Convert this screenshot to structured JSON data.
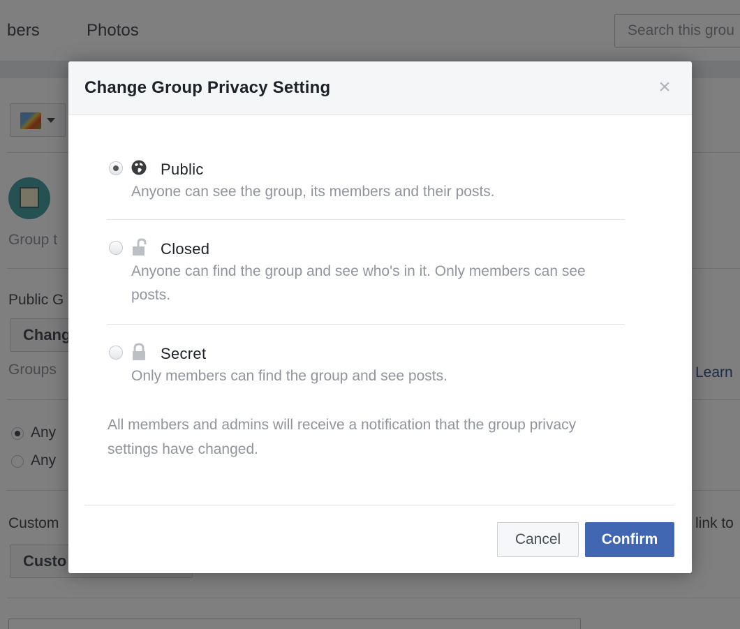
{
  "background": {
    "tabs": [
      "bers",
      "Photos"
    ],
    "search_placeholder": "Search this grou",
    "group_type_label": "Group t",
    "privacy_heading": "Public G",
    "change_button": "Chang",
    "groups_hint": "Groups",
    "learn_link": "Learn",
    "radio_options": [
      "Any",
      "Any"
    ],
    "custom_heading": "Custom",
    "link_text": "link to",
    "custom_button": "Custo"
  },
  "dialog": {
    "title": "Change Group Privacy Setting",
    "close_glyph": "×",
    "options": [
      {
        "label": "Public",
        "icon": "globe-icon",
        "description": "Anyone can see the group, its members and their posts.",
        "selected": true
      },
      {
        "label": "Closed",
        "icon": "unlocked-padlock-icon",
        "description": "Anyone can find the group and see who's in it. Only members can see posts.",
        "selected": false
      },
      {
        "label": "Secret",
        "icon": "locked-padlock-icon",
        "description": "Only members can find the group and see posts.",
        "selected": false
      }
    ],
    "note": "All members and admins will receive a notification that the group privacy settings have changed.",
    "cancel_label": "Cancel",
    "confirm_label": "Confirm"
  },
  "colors": {
    "confirm_blue": "#4267b2",
    "overlay": "rgba(0,0,0,0.5)"
  }
}
